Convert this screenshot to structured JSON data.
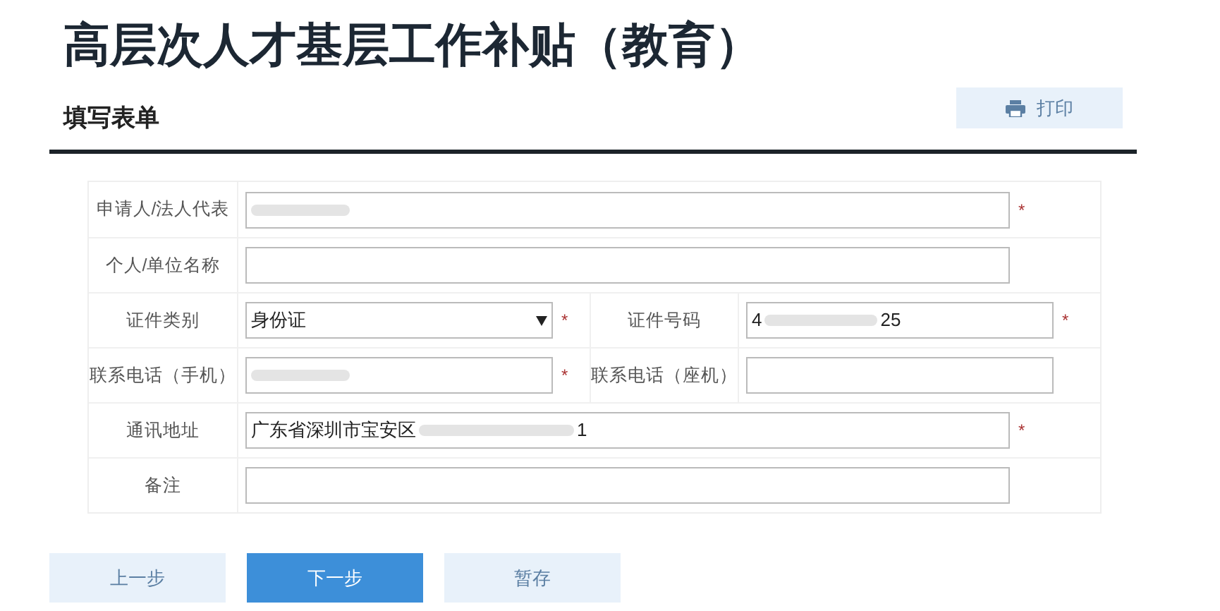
{
  "title": "高层次人才基层工作补贴（教育）",
  "section": {
    "title": "填写表单",
    "print_button": "打印"
  },
  "rows": [
    {
      "cells": [
        {
          "label": "申请人/法人代表",
          "field": {
            "kind": "text",
            "redacted": true,
            "required_mark": "*"
          }
        }
      ]
    },
    {
      "cells": [
        {
          "label": "个人/单位名称",
          "field": {
            "kind": "text"
          }
        }
      ]
    },
    {
      "cells": [
        {
          "label": "证件类别",
          "field": {
            "kind": "select",
            "value": "身份证",
            "required_mark": "*"
          }
        },
        {
          "label": "证件号码",
          "field": {
            "kind": "text",
            "value_start": "4",
            "value_end": "25",
            "redacted": true,
            "required_mark": "*"
          }
        }
      ]
    },
    {
      "cells": [
        {
          "label": "联系电话（手机）",
          "field": {
            "kind": "text",
            "redacted": true,
            "required_mark": "*"
          }
        },
        {
          "label": "联系电话（座机）",
          "field": {
            "kind": "text"
          }
        }
      ]
    },
    {
      "cells": [
        {
          "label": "通讯地址",
          "field": {
            "kind": "text",
            "value_start": "广东省深圳市宝安区",
            "value_end": "1",
            "redacted": true,
            "required_mark": "*"
          }
        }
      ]
    },
    {
      "cells": [
        {
          "label": "备注",
          "field": {
            "kind": "text"
          }
        }
      ]
    }
  ],
  "buttons": [
    {
      "label": "上一步",
      "primary": false
    },
    {
      "label": "下一步",
      "primary": true
    },
    {
      "label": "暂存",
      "primary": false
    }
  ]
}
